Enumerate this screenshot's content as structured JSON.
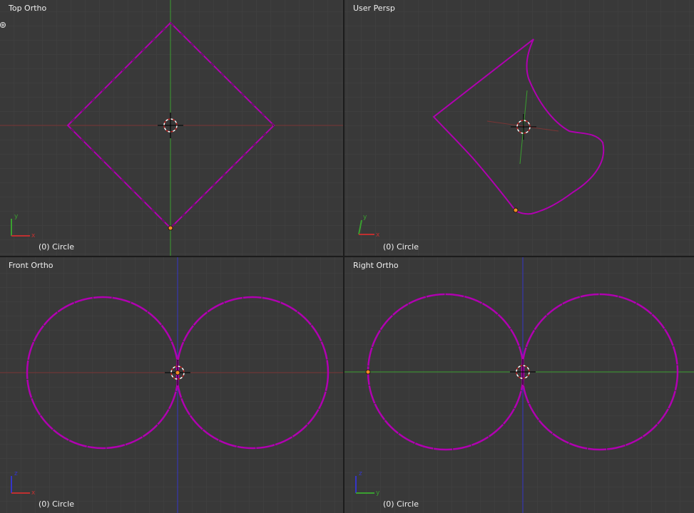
{
  "viewports": [
    {
      "id": "top",
      "title": "Top Ortho",
      "object_label": "(0) Circle",
      "axis_h": "x",
      "axis_v": "y"
    },
    {
      "id": "user",
      "title": "User Persp",
      "object_label": "(0) Circle",
      "axis_h": "x",
      "axis_v": "y"
    },
    {
      "id": "front",
      "title": "Front Ortho",
      "object_label": "(0) Circle",
      "axis_h": "x",
      "axis_v": "z"
    },
    {
      "id": "right",
      "title": "Right Ortho",
      "object_label": "(0) Circle",
      "axis_h": "y",
      "axis_v": "z"
    }
  ],
  "colors": {
    "background": "#393939",
    "grid": "#444444",
    "edge": "#b000b0",
    "x_axis": "#c03030",
    "y_axis": "#3aa030",
    "z_axis": "#3535c8",
    "origin": "#f08a24"
  }
}
